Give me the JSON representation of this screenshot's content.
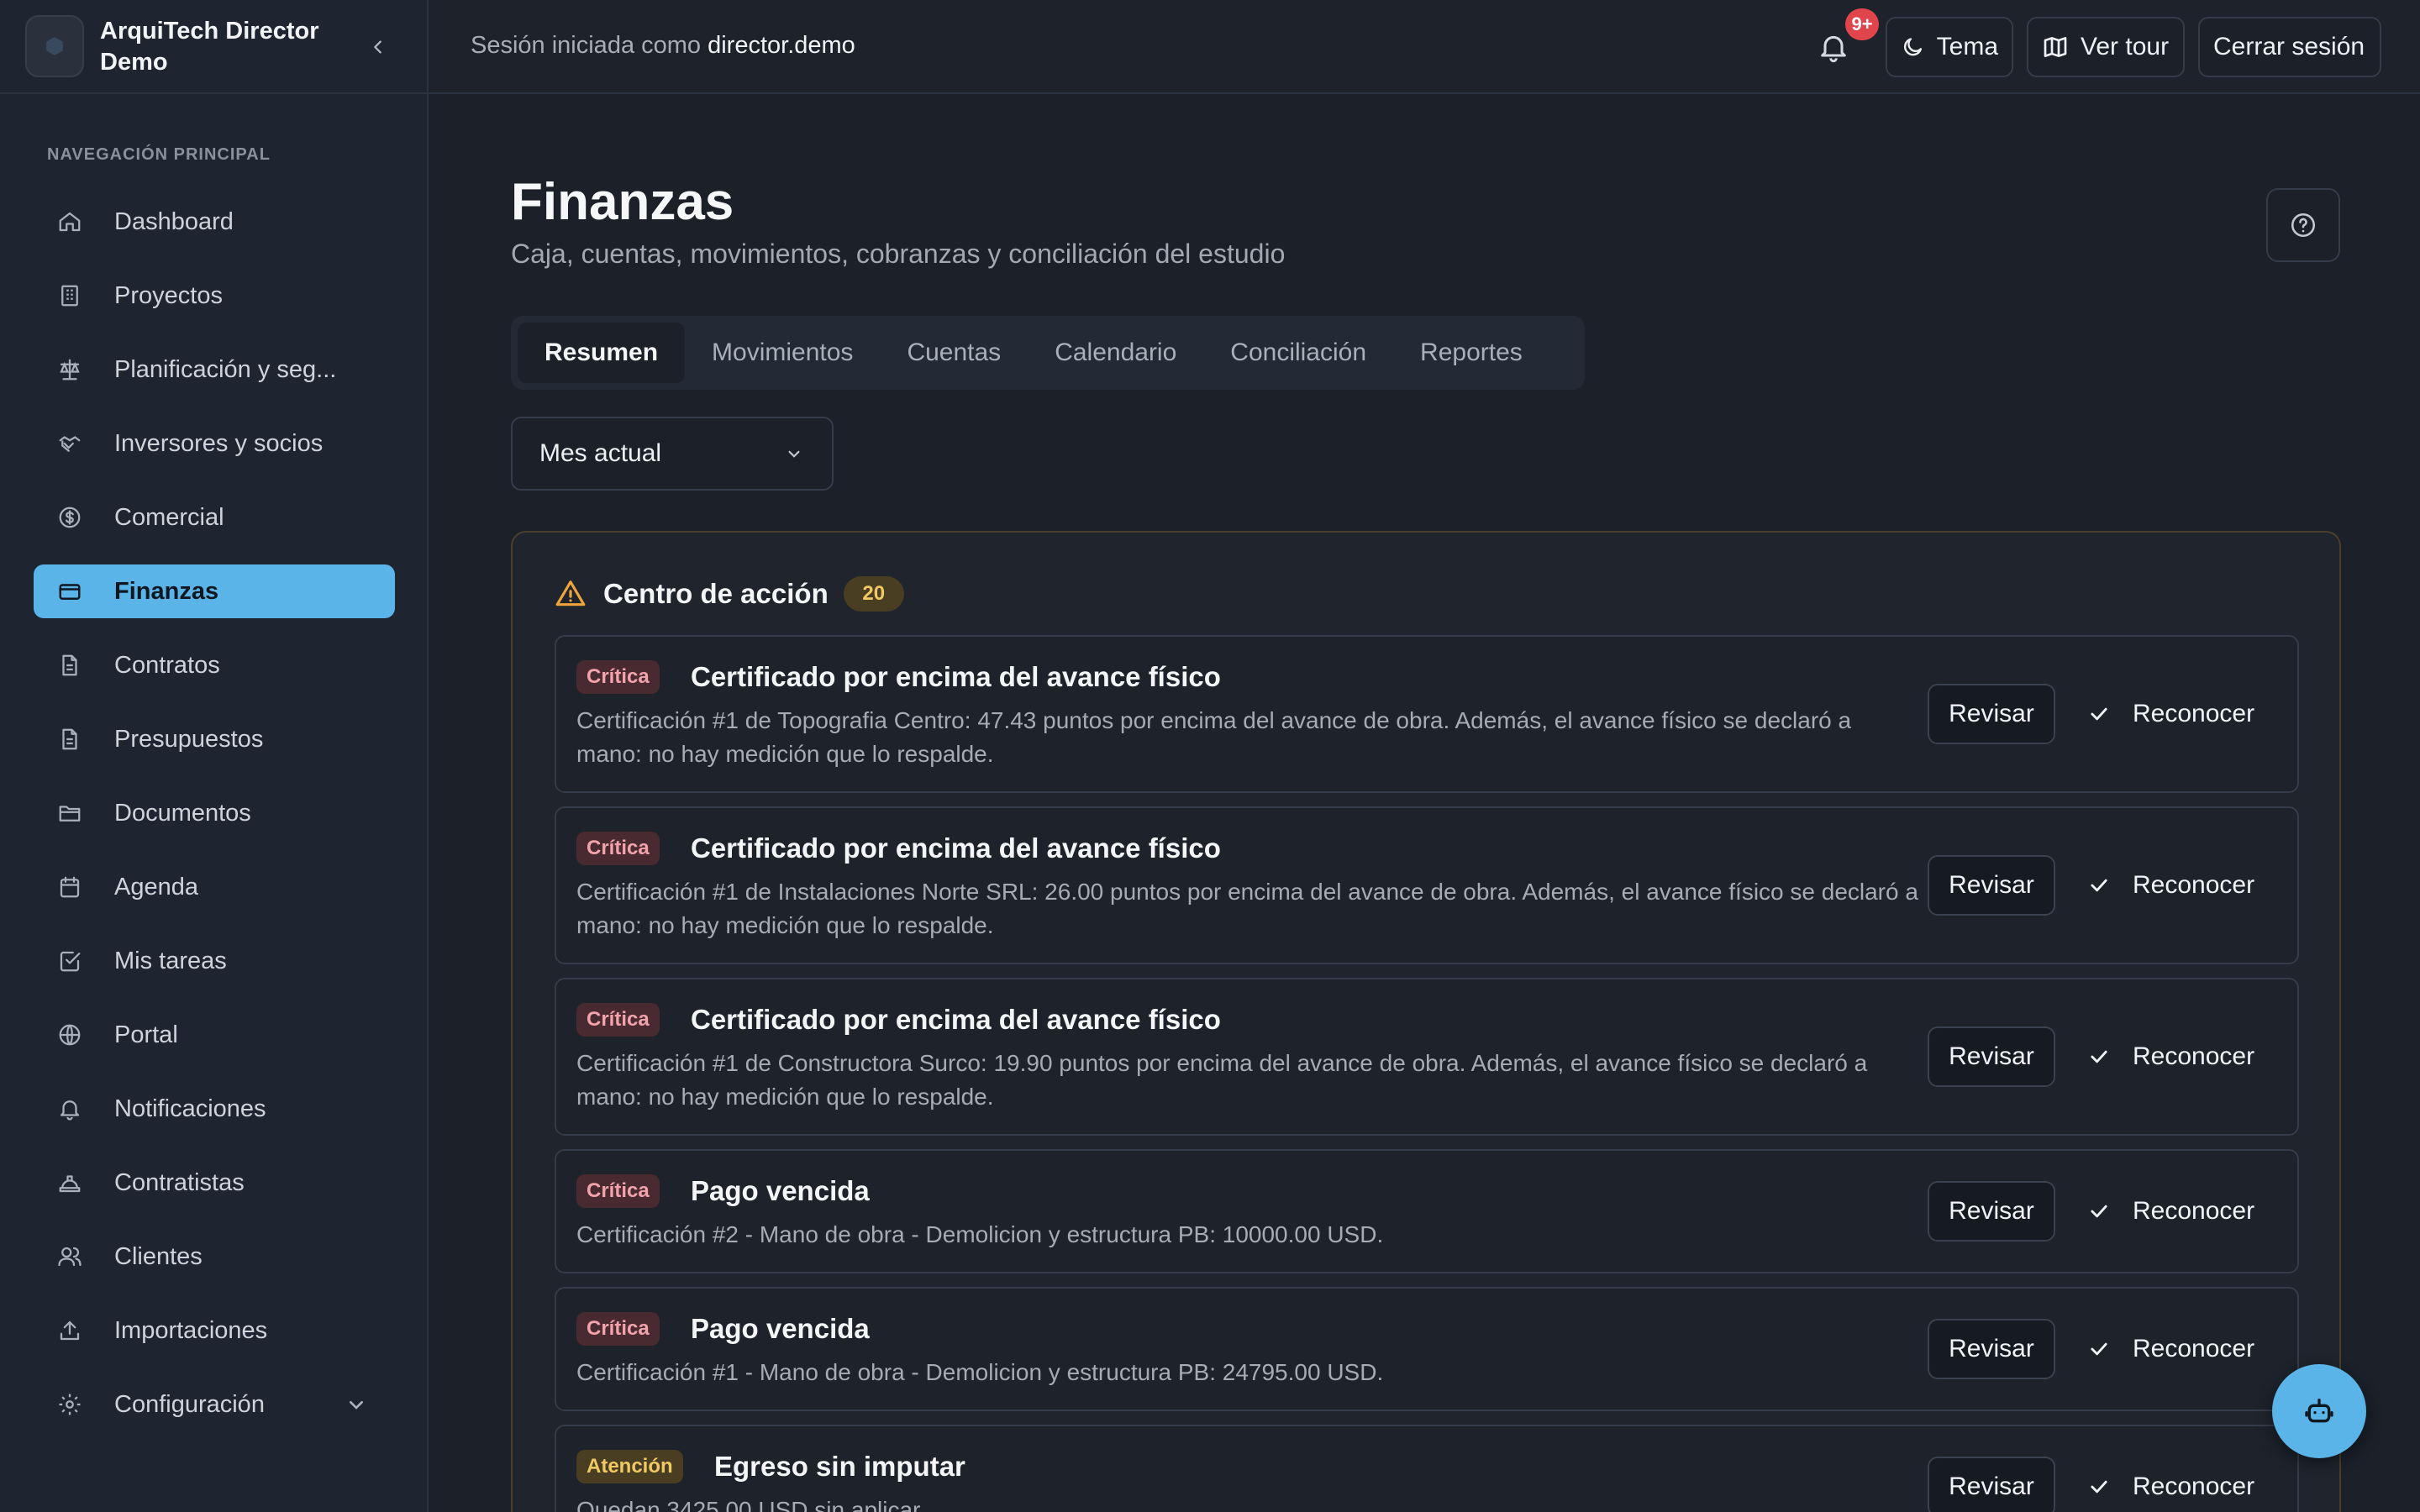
{
  "brand": {
    "name": "ArquiTech Director Demo",
    "logo_icon": "building-icon"
  },
  "sidebar": {
    "section_label": "NAVEGACIÓN PRINCIPAL",
    "items": [
      {
        "label": "Dashboard",
        "icon": "home-icon"
      },
      {
        "label": "Proyectos",
        "icon": "building-icon"
      },
      {
        "label": "Planificación y seg...",
        "icon": "scale-icon"
      },
      {
        "label": "Inversores y socios",
        "icon": "handshake-icon"
      },
      {
        "label": "Comercial",
        "icon": "dollar-icon"
      },
      {
        "label": "Finanzas",
        "icon": "credit-card-icon",
        "active": true
      },
      {
        "label": "Contratos",
        "icon": "document-icon"
      },
      {
        "label": "Presupuestos",
        "icon": "document-icon"
      },
      {
        "label": "Documentos",
        "icon": "folder-icon"
      },
      {
        "label": "Agenda",
        "icon": "calendar-icon"
      },
      {
        "label": "Mis tareas",
        "icon": "checkbox-icon"
      },
      {
        "label": "Portal",
        "icon": "globe-icon"
      },
      {
        "label": "Notificaciones",
        "icon": "bell-icon"
      },
      {
        "label": "Contratistas",
        "icon": "hardhat-icon"
      },
      {
        "label": "Clientes",
        "icon": "users-icon"
      },
      {
        "label": "Importaciones",
        "icon": "upload-icon"
      },
      {
        "label": "Configuración",
        "icon": "gear-icon"
      }
    ]
  },
  "topbar": {
    "session_prefix": "Sesión iniciada como",
    "username": "director.demo",
    "notif_badge": "9+",
    "theme_label": "Tema",
    "tour_label": "Ver tour",
    "logout_label": "Cerrar sesión"
  },
  "page": {
    "title": "Finanzas",
    "subtitle": "Caja, cuentas, movimientos, cobranzas y conciliación del estudio",
    "tabs": [
      "Resumen",
      "Movimientos",
      "Cuentas",
      "Calendario",
      "Conciliación",
      "Reportes"
    ],
    "active_tab": "Resumen",
    "period": "Mes actual"
  },
  "action_center": {
    "title": "Centro de acción",
    "count": "20",
    "review_label": "Revisar",
    "ack_label": "Reconocer",
    "alerts": [
      {
        "severity": "Crítica",
        "title": "Certificado por encima del avance físico",
        "description": "Certificación #1 de Topografia Centro: 47.43 puntos por encima del avance de obra. Además, el avance físico se declaró a mano: no hay medición que lo respalde."
      },
      {
        "severity": "Crítica",
        "title": "Certificado por encima del avance físico",
        "description": "Certificación #1 de Instalaciones Norte SRL: 26.00 puntos por encima del avance de obra. Además, el avance físico se declaró a mano: no hay medición que lo respalde."
      },
      {
        "severity": "Crítica",
        "title": "Certificado por encima del avance físico",
        "description": "Certificación #1 de Constructora Surco: 19.90 puntos por encima del avance de obra. Además, el avance físico se declaró a mano: no hay medición que lo respalde."
      },
      {
        "severity": "Crítica",
        "title": "Pago vencida",
        "description": "Certificación #2 - Mano de obra - Demolicion y estructura PB: 10000.00 USD."
      },
      {
        "severity": "Crítica",
        "title": "Pago vencida",
        "description": "Certificación #1 - Mano de obra - Demolicion y estructura PB: 24795.00 USD."
      },
      {
        "severity": "Atención",
        "title": "Egreso sin imputar",
        "description": "Quedan 3425.00 USD sin aplicar."
      }
    ]
  },
  "colors": {
    "accent": "#5ab4e8",
    "critical": "#f2a3ab",
    "warning": "#f1c964",
    "background": "#1b2029"
  }
}
